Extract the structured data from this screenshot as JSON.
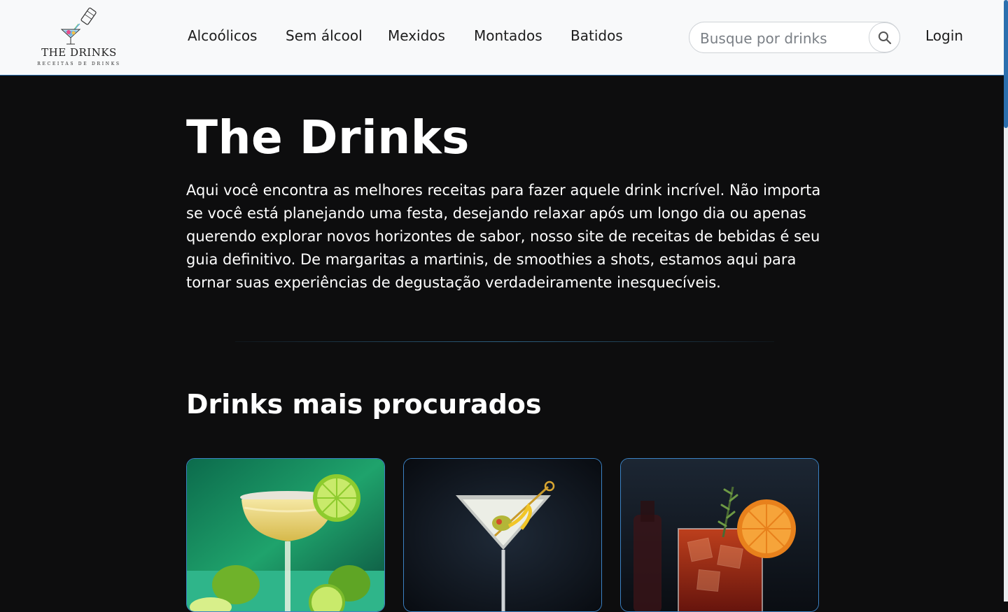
{
  "brand": {
    "logo_title": "THE DRINKS",
    "logo_subtitle": "RECEITAS DE DRINKS",
    "accent": "#3b82c4",
    "background": "#0d0d0e",
    "header_bg": "#f8f9fa"
  },
  "nav": {
    "items": [
      {
        "label": "Alcoólicos"
      },
      {
        "label": "Sem álcool"
      },
      {
        "label": "Mexidos"
      },
      {
        "label": "Montados"
      },
      {
        "label": "Batidos"
      }
    ]
  },
  "search": {
    "placeholder": "Busque por drinks",
    "icon": "search-icon"
  },
  "login": {
    "label": "Login"
  },
  "hero": {
    "title": "The Drinks",
    "text": "Aqui você encontra as melhores receitas para fazer aquele drink incrível. Não importa se você está planejando uma festa, desejando relaxar após um longo dia ou apenas querendo explorar novos horizontes de sabor, nosso site de receitas de bebidas é seu guia definitivo. De margaritas a martinis, de smoothies a shots, estamos aqui para tornar suas experiências de degustação verdadeiramente inesquecíveis."
  },
  "popular": {
    "title": "Drinks mais procurados",
    "cards": [
      {
        "image": "margarita-image"
      },
      {
        "image": "martini-image"
      },
      {
        "image": "negroni-image"
      }
    ]
  }
}
